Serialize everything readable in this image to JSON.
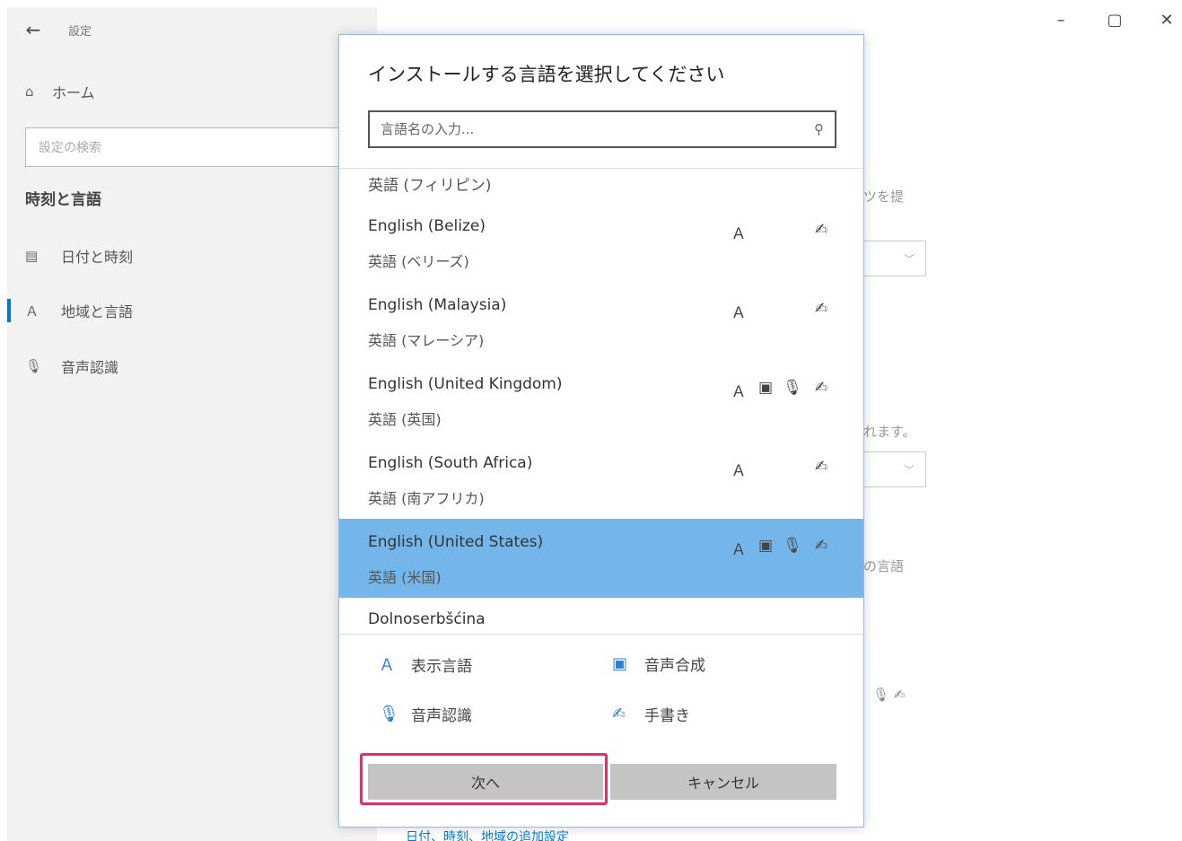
{
  "window": {
    "app_title": "設定",
    "controls": {
      "minimize": "–",
      "maximize": "▢",
      "close": "✕"
    }
  },
  "sidebar": {
    "home_label": "ホーム",
    "search_placeholder": "設定の検索",
    "section_title": "時刻と言語",
    "items": [
      {
        "label": "日付と時刻",
        "icon": "calendar-clock-icon"
      },
      {
        "label": "地域と言語",
        "icon": "language-icon",
        "active": true
      },
      {
        "label": "音声認識",
        "icon": "microphone-icon"
      }
    ]
  },
  "background": {
    "snippet1": "ツを提",
    "snippet2": "れます。",
    "snippet3": "の言語",
    "link": "日付、時刻、地域の追加設定"
  },
  "dialog": {
    "title": "インストールする言語を選択してください",
    "search_placeholder": "言語名の入力...",
    "partial_top": "英語 (フィリピン)",
    "languages": [
      {
        "name": "English (Belize)",
        "sub": "英語 (ベリーズ)",
        "features": [
          "display",
          "handwriting"
        ]
      },
      {
        "name": "English (Malaysia)",
        "sub": "英語 (マレーシア)",
        "features": [
          "display",
          "handwriting"
        ]
      },
      {
        "name": "English (United Kingdom)",
        "sub": "英語 (英国)",
        "features": [
          "display",
          "tts",
          "speech",
          "handwriting"
        ]
      },
      {
        "name": "English (South Africa)",
        "sub": "英語 (南アフリカ)",
        "features": [
          "display",
          "handwriting"
        ]
      },
      {
        "name": "English (United States)",
        "sub": "英語 (米国)",
        "features": [
          "display",
          "tts",
          "speech",
          "handwriting"
        ],
        "selected": true
      }
    ],
    "partial_bottom": "Dolnoserbšćina",
    "legend": {
      "display": "表示言語",
      "tts": "音声合成",
      "speech": "音声認識",
      "handwriting": "手書き"
    },
    "next_label": "次へ",
    "cancel_label": "キャンセル"
  },
  "colors": {
    "selected_row": "#75b6ea",
    "accent": "#0078d7",
    "highlight_box": "#e0306c"
  }
}
